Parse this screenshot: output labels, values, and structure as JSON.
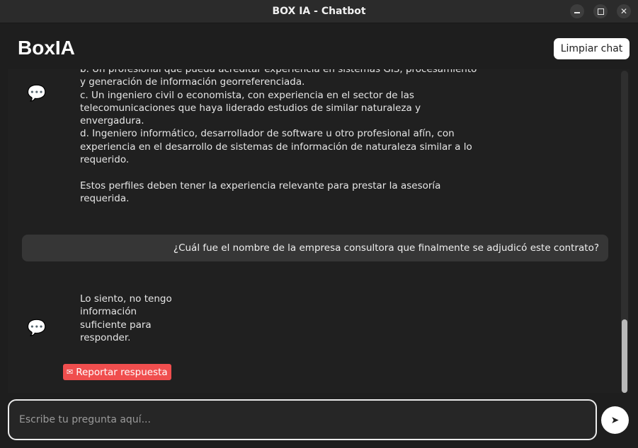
{
  "window": {
    "title": "BOX IA - Chatbot",
    "controls": {
      "minimize": "minimize-icon",
      "maximize": "maximize-icon",
      "close": "✕"
    }
  },
  "header": {
    "app_title": "BoxIA",
    "clear_label": "Limpiar chat"
  },
  "messages": [
    {
      "role": "bot",
      "icon": "💬",
      "text": "b. Un profesional que pueda acreditar experiencia en sistemas GIS, procesamiento\ny generación de información georreferenciada.\nc. Un ingeniero civil o economista, con experiencia en el sector de las\ntelecomunicaciones que haya liderado estudios de similar naturaleza y\nenvergadura.\nd. Ingeniero informático, desarrollador de software u otro profesional afín, con\nexperiencia en el desarrollo de sistemas de información de naturaleza similar a lo\nrequerido.\n\nEstos perfiles deben tener la experiencia relevante para prestar la asesoría\nrequerida."
    },
    {
      "role": "user",
      "text": "¿Cuál fue el nombre de la empresa consultora que finalmente se adjudicó este contrato?"
    },
    {
      "role": "bot",
      "icon": "💬",
      "text": "Lo siento, no tengo\ninformación\nsuficiente para\nresponder.",
      "report_label": "Reportar respuesta",
      "report_icon": "✉"
    }
  ],
  "input": {
    "placeholder": "Escribe tu pregunta aquí...",
    "value": "",
    "send_icon": "➤"
  },
  "colors": {
    "background": "#1e1e1e",
    "chat_background": "#202020",
    "user_bubble": "#363636",
    "report_button": "#f04e4e",
    "accent_white": "#ffffff"
  }
}
